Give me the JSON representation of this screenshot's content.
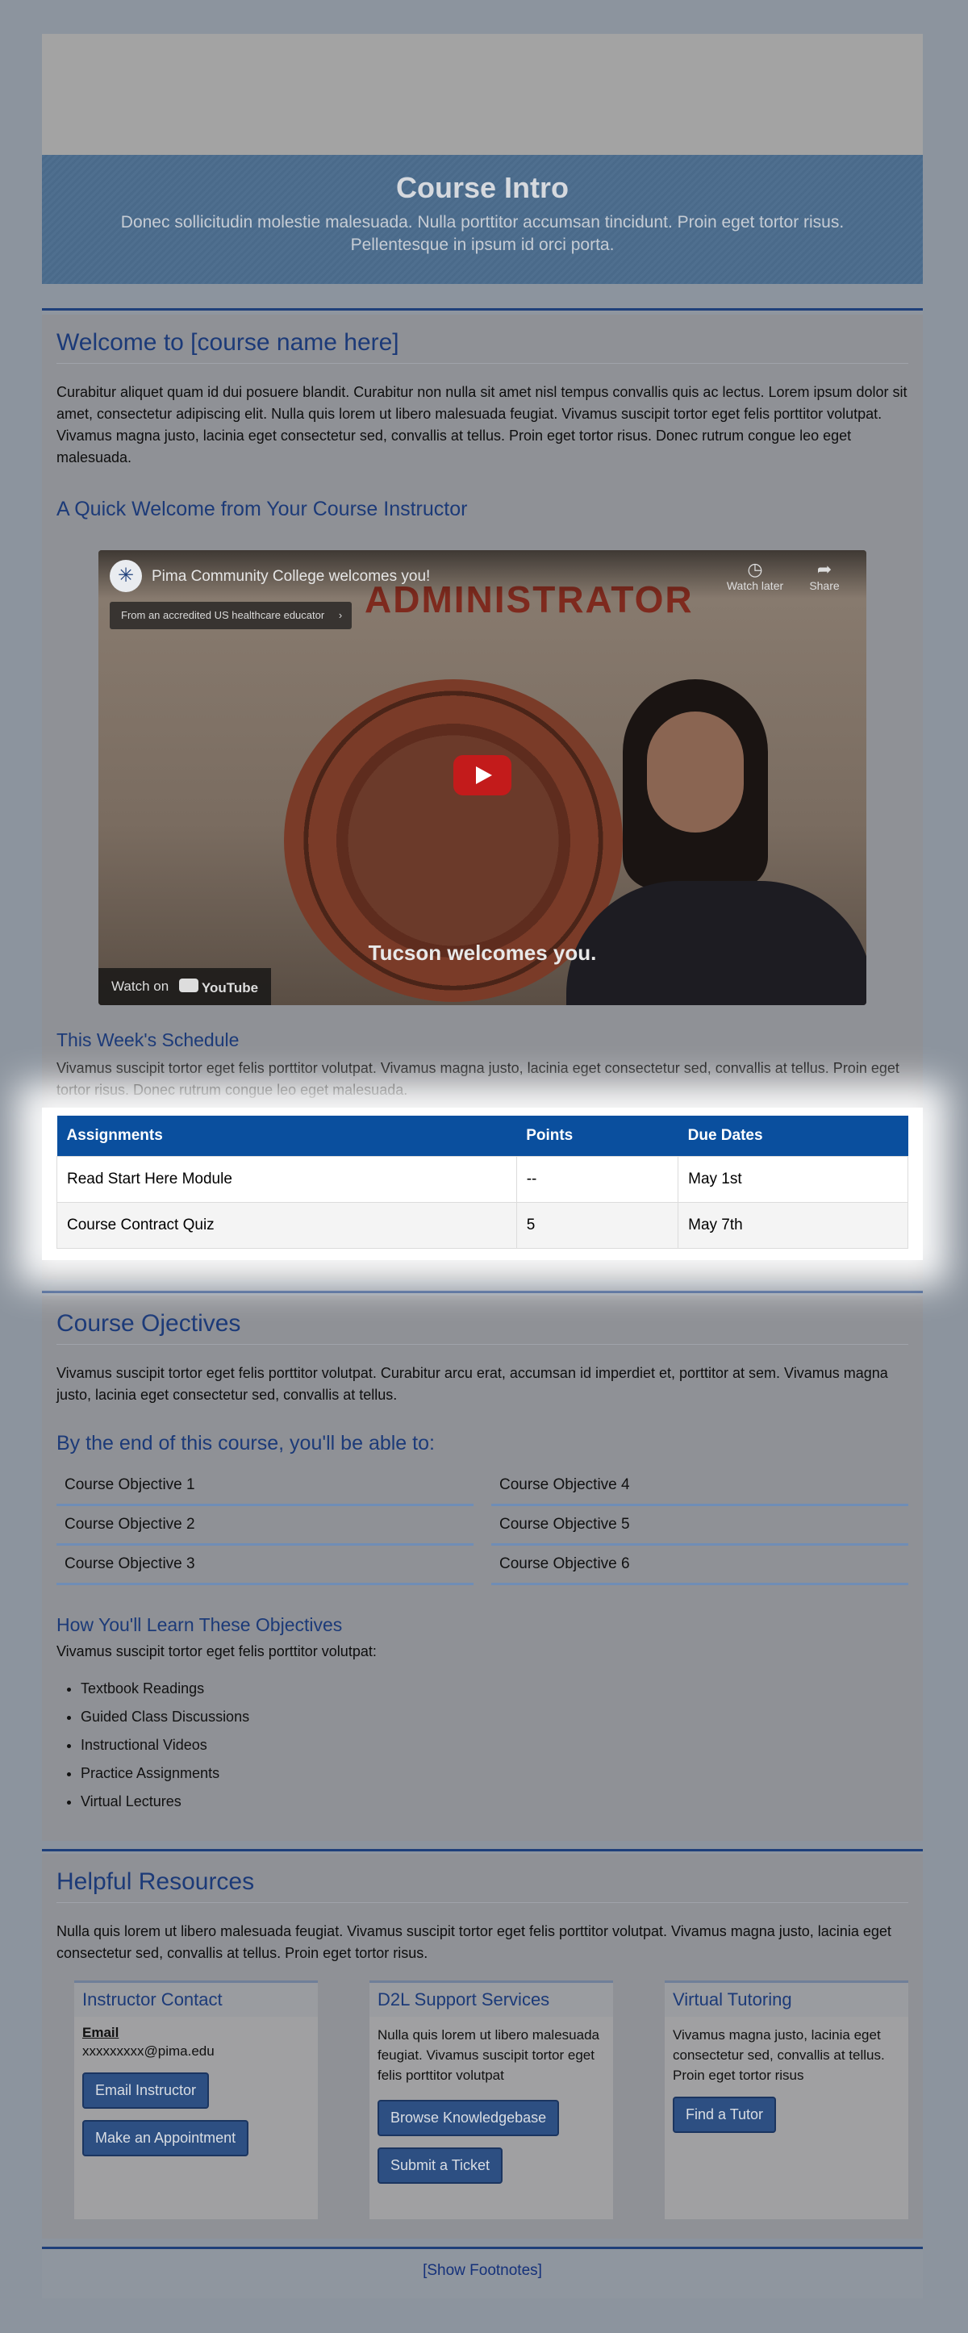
{
  "hero": {
    "title": "Course Intro",
    "subtitle": "Donec sollicitudin molestie malesuada. Nulla porttitor accumsan tincidunt. Proin eget tortor risus. Pellentesque in ipsum id orci porta."
  },
  "welcome": {
    "title": "Welcome to [course name here]",
    "text": "Curabitur aliquet quam id dui posuere blandit. Curabitur non nulla sit amet nisl tempus convallis quis ac lectus. Lorem ipsum dolor sit amet, consectetur adipiscing elit. Nulla quis lorem ut libero malesuada feugiat. Vivamus suscipit tortor eget felis porttitor volutpat. Vivamus magna justo, lacinia eget consectetur sed, convallis at tellus. Proin eget tortor risus. Donec rutrum congue leo eget malesuada.",
    "instructor_heading": "A Quick Welcome from Your Course Instructor"
  },
  "video": {
    "title": "Pima Community College welcomes you!",
    "chip": "From an accredited US healthcare educator",
    "watch_later": "Watch later",
    "share": "Share",
    "wall_text": "ADMINISTRATOR",
    "caption": "Tucson welcomes you.",
    "watch_on": "Watch on",
    "youtube": "YouTube"
  },
  "schedule": {
    "heading": "This Week's Schedule",
    "text": "Vivamus suscipit tortor eget felis porttitor volutpat. Vivamus magna justo, lacinia eget consectetur sed, convallis at tellus. Proin eget tortor risus. Donec rutrum congue leo eget malesuada.",
    "columns": [
      "Assignments",
      "Points",
      "Due Dates"
    ],
    "rows": [
      [
        "Read Start Here Module",
        "--",
        "May 1st"
      ],
      [
        "Course Contract Quiz",
        "5",
        "May 7th"
      ]
    ]
  },
  "objectives": {
    "title": "Course Ojectives",
    "text": "Vivamus suscipit tortor eget felis porttitor volutpat. Curabitur arcu erat, accumsan id imperdiet et, porttitor at sem. Vivamus magna justo, lacinia eget consectetur sed, convallis at tellus.",
    "able_heading": "By the end of this course, you'll be able to:",
    "items": [
      "Course Objective 1",
      "Course Objective 4",
      "Course Objective 2",
      "Course Objective 5",
      "Course Objective 3",
      "Course Objective 6"
    ],
    "learn_heading": "How You'll Learn These Objectives",
    "learn_text": "Vivamus suscipit tortor eget felis porttitor volutpat:",
    "learn_items": [
      "Textbook Readings",
      "Guided Class Discussions",
      "Instructional Videos",
      "Practice Assignments",
      "Virtual Lectures"
    ]
  },
  "resources": {
    "title": "Helpful Resources",
    "text": "Nulla quis lorem ut libero malesuada feugiat. Vivamus suscipit tortor eget felis porttitor volutpat. Vivamus magna justo, lacinia eget consectetur sed, convallis at tellus. Proin eget tortor risus.",
    "contact": {
      "title": "Instructor Contact",
      "email_label": "Email",
      "email": "xxxxxxxxx@pima.edu",
      "btn_email": "Email Instructor",
      "btn_appt": "Make an Appointment"
    },
    "support": {
      "title": "D2L Support Services",
      "text": "Nulla quis lorem ut libero malesuada feugiat. Vivamus suscipit tortor eget felis porttitor volutpat",
      "btn_kb": "Browse Knowledgebase",
      "btn_ticket": "Submit a Ticket"
    },
    "tutoring": {
      "title": "Virtual Tutoring",
      "text": "Vivamus magna justo, lacinia eget consectetur sed, convallis at tellus. Proin eget tortor risus",
      "btn_tutor": "Find a Tutor"
    }
  },
  "footer": {
    "link": "[Show Footnotes]"
  }
}
